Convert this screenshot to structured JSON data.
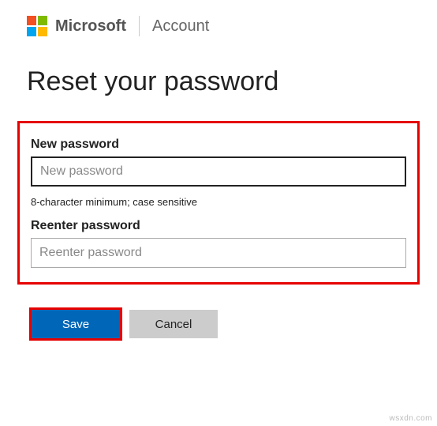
{
  "header": {
    "brand": "Microsoft",
    "section": "Account"
  },
  "page": {
    "title": "Reset your password"
  },
  "form": {
    "new_password": {
      "label": "New password",
      "placeholder": "New password",
      "hint": "8-character minimum; case sensitive"
    },
    "reenter_password": {
      "label": "Reenter password",
      "placeholder": "Reenter password"
    }
  },
  "buttons": {
    "save": "Save",
    "cancel": "Cancel"
  },
  "watermark": "wsxdn.com"
}
